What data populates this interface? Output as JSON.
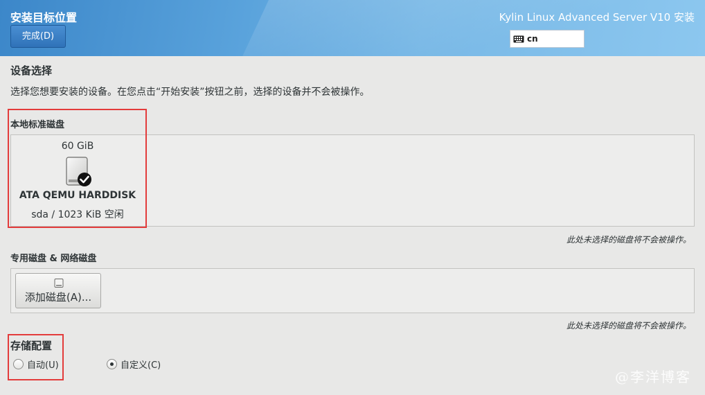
{
  "header": {
    "page_title": "安装目标位置",
    "done_label": "完成(D)",
    "product_title": "Kylin Linux Advanced Server V10 安装",
    "keyboard_layout": "cn",
    "keyboard_icon": "keyboard-icon",
    "accent": "#3c87c9"
  },
  "device_selection": {
    "title": "设备选择",
    "description": "选择您想要安装的设备。在您点击“开始安装”按钮之前，选择的设备并不会被操作。"
  },
  "local_disks": {
    "label": "本地标准磁盘",
    "disks": [
      {
        "size": "60 GiB",
        "name": "ATA QEMU HARDDISK",
        "info": "sda  /  1023 KiB 空闲",
        "selected": true,
        "icon": "harddisk-icon"
      }
    ],
    "hint": "此处未选择的磁盘将不会被操作。"
  },
  "specialized_disks": {
    "label": "专用磁盘 & 网络磁盘",
    "add_button_label": "添加磁盘(A)...",
    "add_button_icon": "disk-add-icon",
    "hint": "此处未选择的磁盘将不会被操作。"
  },
  "storage_config": {
    "title": "存储配置",
    "options": [
      {
        "label": "自动(U)",
        "checked": false
      },
      {
        "label": "自定义(C)",
        "checked": true
      }
    ]
  },
  "watermark": "@李洋博客",
  "highlight_color": "#e33b3b"
}
